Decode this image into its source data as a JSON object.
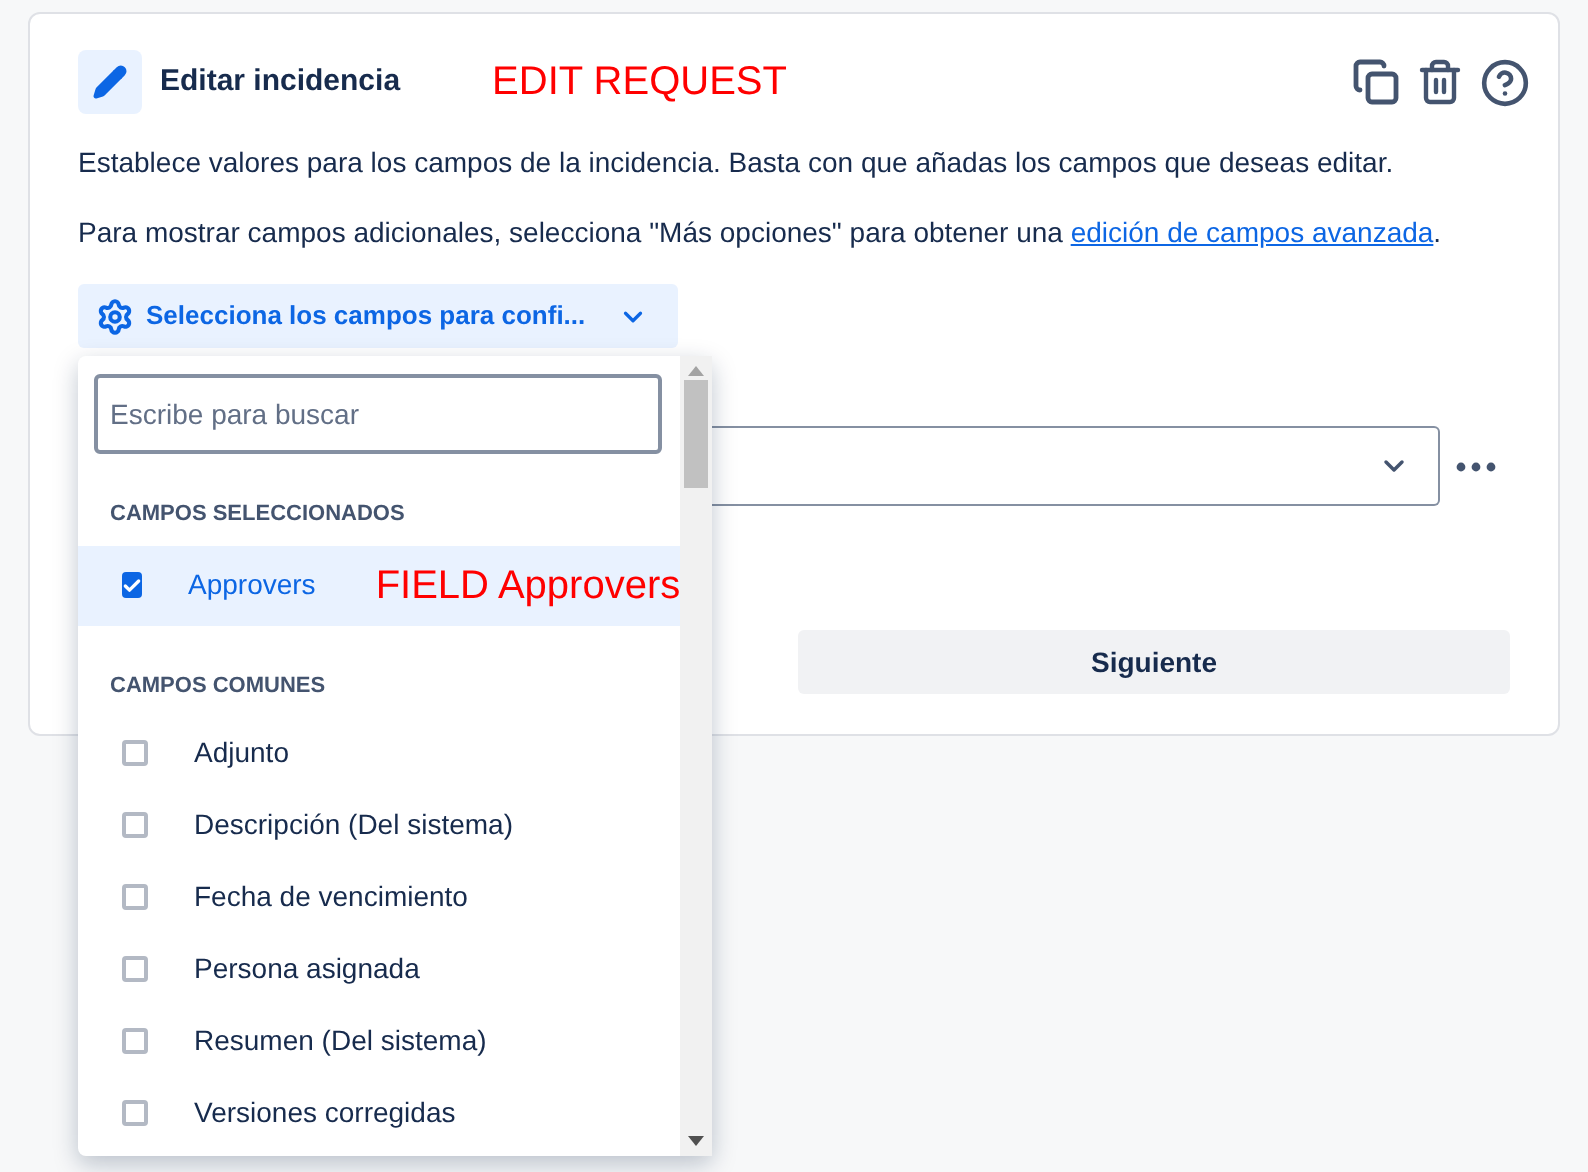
{
  "header": {
    "title": "Editar incidencia",
    "annotation": "EDIT REQUEST"
  },
  "description": "Establece valores para los campos de la incidencia. Basta con que añadas los campos que deseas editar.",
  "hint": {
    "text": "Para mostrar campos adicionales, selecciona \"Más opciones\" para obtener una ",
    "link": "edición de campos avanzada",
    "after": "."
  },
  "field_selector": {
    "label": "Selecciona los campos para confi...",
    "expanded": true
  },
  "next_button": "Siguiente",
  "dropdown": {
    "search": {
      "placeholder": "Escribe para buscar"
    },
    "annotation": "FIELD Approvers",
    "groups": [
      {
        "heading": "CAMPOS SELECCIONADOS",
        "items": [
          {
            "label": "Approvers",
            "checked": true,
            "selected": true
          }
        ]
      },
      {
        "heading": "CAMPOS COMUNES",
        "items": [
          {
            "label": "Adjunto",
            "checked": false,
            "selected": false
          },
          {
            "label": "Descripción (Del sistema)",
            "checked": false,
            "selected": false
          },
          {
            "label": "Fecha de vencimiento",
            "checked": false,
            "selected": false
          },
          {
            "label": "Persona asignada",
            "checked": false,
            "selected": false
          },
          {
            "label": "Resumen (Del sistema)",
            "checked": false,
            "selected": false
          },
          {
            "label": "Versiones corregidas",
            "checked": false,
            "selected": false
          }
        ]
      }
    ]
  }
}
